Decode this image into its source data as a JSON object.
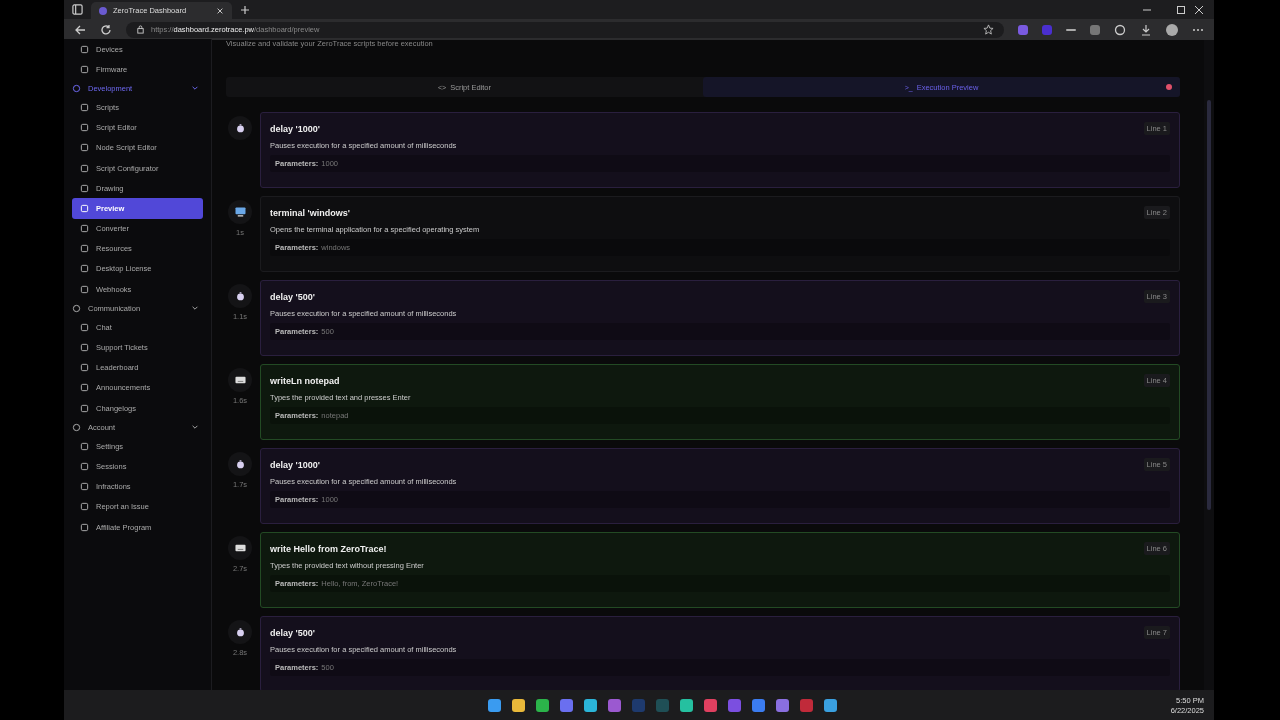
{
  "browser": {
    "tab_title": "ZeroTrace Dashboard",
    "url_host": "dashboard.zerotrace.pw",
    "url_prefix": "https://",
    "url_path": "/dashboard/preview"
  },
  "sidebar": {
    "items": [
      {
        "kind": "item",
        "label": "Devices",
        "selected": false
      },
      {
        "kind": "item",
        "label": "Firmware",
        "selected": false
      },
      {
        "kind": "group",
        "label": "Development",
        "expanded": true,
        "selected": true
      },
      {
        "kind": "item",
        "label": "Scripts",
        "selected": false
      },
      {
        "kind": "item",
        "label": "Script Editor",
        "selected": false
      },
      {
        "kind": "item",
        "label": "Node Script Editor",
        "selected": false
      },
      {
        "kind": "item",
        "label": "Script Configurator",
        "selected": false
      },
      {
        "kind": "item",
        "label": "Drawing",
        "selected": false
      },
      {
        "kind": "item",
        "label": "Preview",
        "selected": true
      },
      {
        "kind": "item",
        "label": "Converter",
        "selected": false
      },
      {
        "kind": "item",
        "label": "Resources",
        "selected": false
      },
      {
        "kind": "item",
        "label": "Desktop License",
        "selected": false
      },
      {
        "kind": "item",
        "label": "Webhooks",
        "selected": false
      },
      {
        "kind": "group",
        "label": "Communication",
        "expanded": true,
        "selected": false
      },
      {
        "kind": "item",
        "label": "Chat",
        "selected": false
      },
      {
        "kind": "item",
        "label": "Support Tickets",
        "selected": false
      },
      {
        "kind": "item",
        "label": "Leaderboard",
        "selected": false
      },
      {
        "kind": "item",
        "label": "Announcements",
        "selected": false
      },
      {
        "kind": "item",
        "label": "Changelogs",
        "selected": false
      },
      {
        "kind": "group",
        "label": "Account",
        "expanded": true,
        "selected": false
      },
      {
        "kind": "item",
        "label": "Settings",
        "selected": false
      },
      {
        "kind": "item",
        "label": "Sessions",
        "selected": false
      },
      {
        "kind": "item",
        "label": "Infractions",
        "selected": false
      },
      {
        "kind": "item",
        "label": "Report an Issue",
        "selected": false
      },
      {
        "kind": "item",
        "label": "Affiliate Program",
        "selected": false
      }
    ]
  },
  "page": {
    "subtitle": "Visualize and validate your ZeroTrace scripts before execution"
  },
  "tabs": [
    {
      "label": "Script Editor",
      "icon": "<>",
      "selected": false
    },
    {
      "label": "Execution Preview",
      "icon": ">_",
      "selected": true
    }
  ],
  "steps": [
    {
      "kind": "delay",
      "command": "delay '1000'",
      "description": "Pauses execution for a specified amount of milliseconds",
      "params_label": "Parameters:",
      "params": "1000",
      "line": "Line 1"
    },
    {
      "kind": "terminal",
      "command": "terminal 'windows'",
      "description": "Opens the terminal application for a specified operating system",
      "params_label": "Parameters:",
      "params": "windows",
      "line": "Line 2",
      "time": "1s"
    },
    {
      "kind": "delay",
      "command": "delay '500'",
      "description": "Pauses execution for a specified amount of milliseconds",
      "params_label": "Parameters:",
      "params": "500",
      "line": "Line 3",
      "time": "1.1s"
    },
    {
      "kind": "write",
      "command": "writeLn notepad",
      "description": "Types the provided text and presses Enter",
      "params_label": "Parameters:",
      "params": "notepad",
      "line": "Line 4",
      "time": "1.6s"
    },
    {
      "kind": "delay",
      "command": "delay '1000'",
      "description": "Pauses execution for a specified amount of milliseconds",
      "params_label": "Parameters:",
      "params": "1000",
      "line": "Line 5",
      "time": "1.7s"
    },
    {
      "kind": "write",
      "command": "write Hello from ZeroTrace!",
      "description": "Types the provided text without pressing Enter",
      "params_label": "Parameters:",
      "params": "Hello, from, ZeroTrace!",
      "line": "Line 6",
      "time": "2.7s"
    },
    {
      "kind": "delay",
      "command": "delay '500'",
      "description": "Pauses execution for a specified amount of milliseconds",
      "params_label": "Parameters:",
      "params": "500",
      "line": "Line 7",
      "time": "2.8s"
    }
  ],
  "taskbar": {
    "apps": [
      {
        "color": "#3a9bf0"
      },
      {
        "color": "#e8b83a"
      },
      {
        "color": "#2bb34a"
      },
      {
        "color": "#6a6ff0"
      },
      {
        "color": "#2bb5d9"
      },
      {
        "color": "#9b59d0"
      },
      {
        "color": "#1e3a6e"
      },
      {
        "color": "#1f4f56"
      },
      {
        "color": "#25c0a0"
      },
      {
        "color": "#e04060"
      },
      {
        "color": "#7b4fe0"
      },
      {
        "color": "#3b7cf0"
      },
      {
        "color": "#8a6fe0"
      },
      {
        "color": "#c02a3a"
      },
      {
        "color": "#3aa0e0"
      }
    ],
    "time": "5:50 PM",
    "date": "6/22/2025"
  }
}
